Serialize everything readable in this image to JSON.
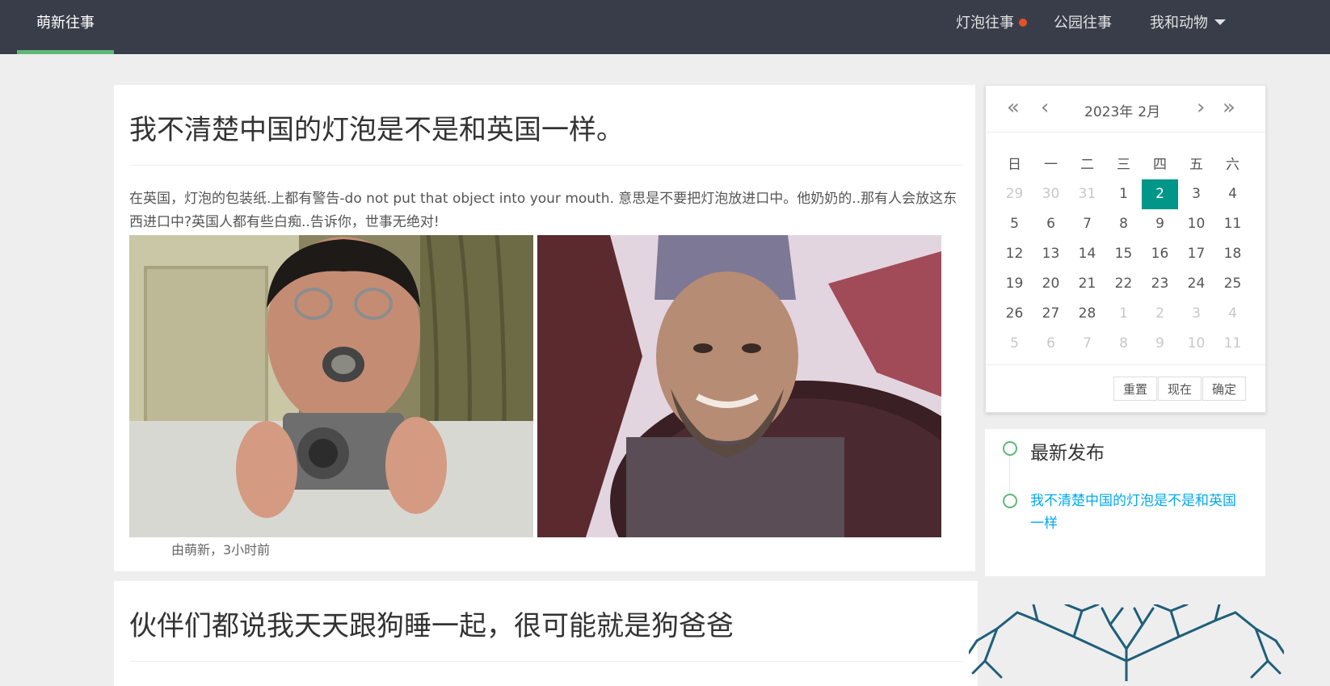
{
  "nav": {
    "brand": "萌新往事",
    "items": [
      {
        "label": "灯泡往事"
      },
      {
        "label": "公园往事"
      },
      {
        "label": "我和动物"
      }
    ]
  },
  "post1": {
    "title": "我不清楚中国的灯泡是不是和英国一样。",
    "body": "在英国，灯泡的包装纸.上都有警告-do not put that object into your mouth. 意思是不要把灯泡放进口中。他奶奶的..那有人会放这东西进口中?英国人都有些白痴..告诉你，世事无绝对!",
    "meta": "由萌新，3小时前"
  },
  "post2": {
    "title": "伙伴们都说我天天跟狗睡一起，很可能就是狗爸爸"
  },
  "calendar": {
    "year": "2023年",
    "month": "2月",
    "weekdays": [
      "日",
      "一",
      "二",
      "三",
      "四",
      "五",
      "六"
    ],
    "rows": [
      [
        "29",
        "30",
        "31",
        "1",
        "2",
        "3",
        "4"
      ],
      [
        "5",
        "6",
        "7",
        "8",
        "9",
        "10",
        "11"
      ],
      [
        "12",
        "13",
        "14",
        "15",
        "16",
        "17",
        "18"
      ],
      [
        "19",
        "20",
        "21",
        "22",
        "23",
        "24",
        "25"
      ],
      [
        "26",
        "27",
        "28",
        "1",
        "2",
        "3",
        "4"
      ],
      [
        "5",
        "6",
        "7",
        "8",
        "9",
        "10",
        "11"
      ]
    ],
    "selected": "2",
    "buttons": {
      "reset": "重置",
      "now": "现在",
      "confirm": "确定"
    }
  },
  "latest": {
    "title": "最新发布",
    "link": "我不清楚中国的灯泡是不是和英国一样"
  },
  "colors": {
    "topbar": "#393d49",
    "accent": "#5fb878",
    "selected_day": "#009688",
    "link": "#01aaed",
    "badge": "#ff5722"
  }
}
